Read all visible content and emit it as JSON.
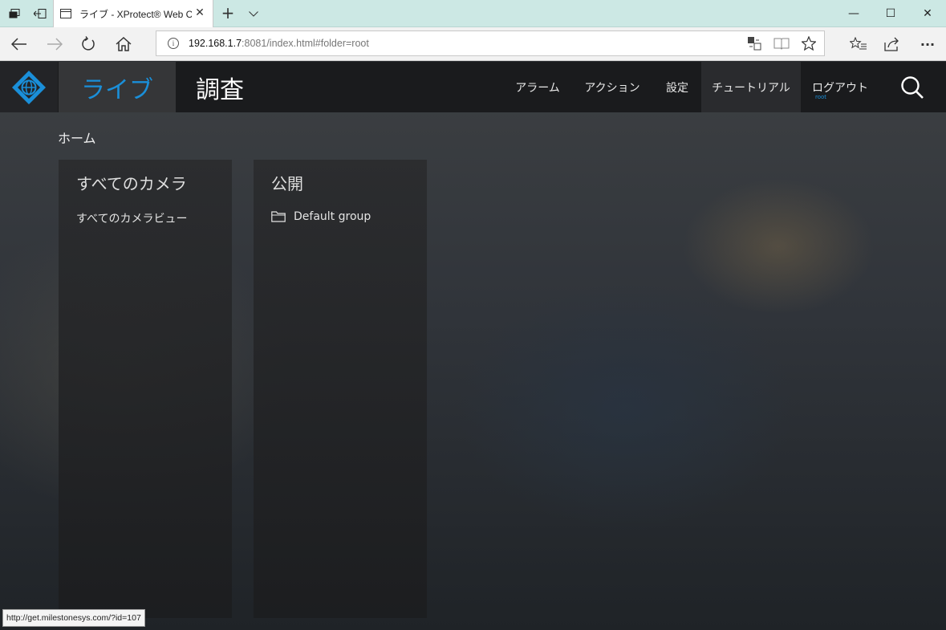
{
  "browser": {
    "tab_title": "ライブ - XProtect® Web Client",
    "new_tab_symbol": "+",
    "tab_close_symbol": "✕",
    "url_host": "192.168.1.7",
    "url_rest": ":8081/index.html#folder=root",
    "window": {
      "minimize": "—",
      "maximize": "☐",
      "close": "✕"
    },
    "more_symbol": "···",
    "status_url": "http://get.milestonesys.com/?id=107"
  },
  "app": {
    "nav_live": "ライブ",
    "nav_investigation": "調査",
    "menu": {
      "alarms": "アラーム",
      "actions": "アクション",
      "settings": "設定",
      "tutorial": "チュートリアル",
      "logout": "ログアウト"
    },
    "username": "root",
    "breadcrumb": "ホーム",
    "panels": {
      "all_cameras_title": "すべてのカメラ",
      "all_cameras_item": "すべてのカメラビュー",
      "public_title": "公開",
      "public_item": "Default group"
    },
    "colors": {
      "accent": "#1a8fd9",
      "topbar": "#1a1b1d"
    }
  }
}
